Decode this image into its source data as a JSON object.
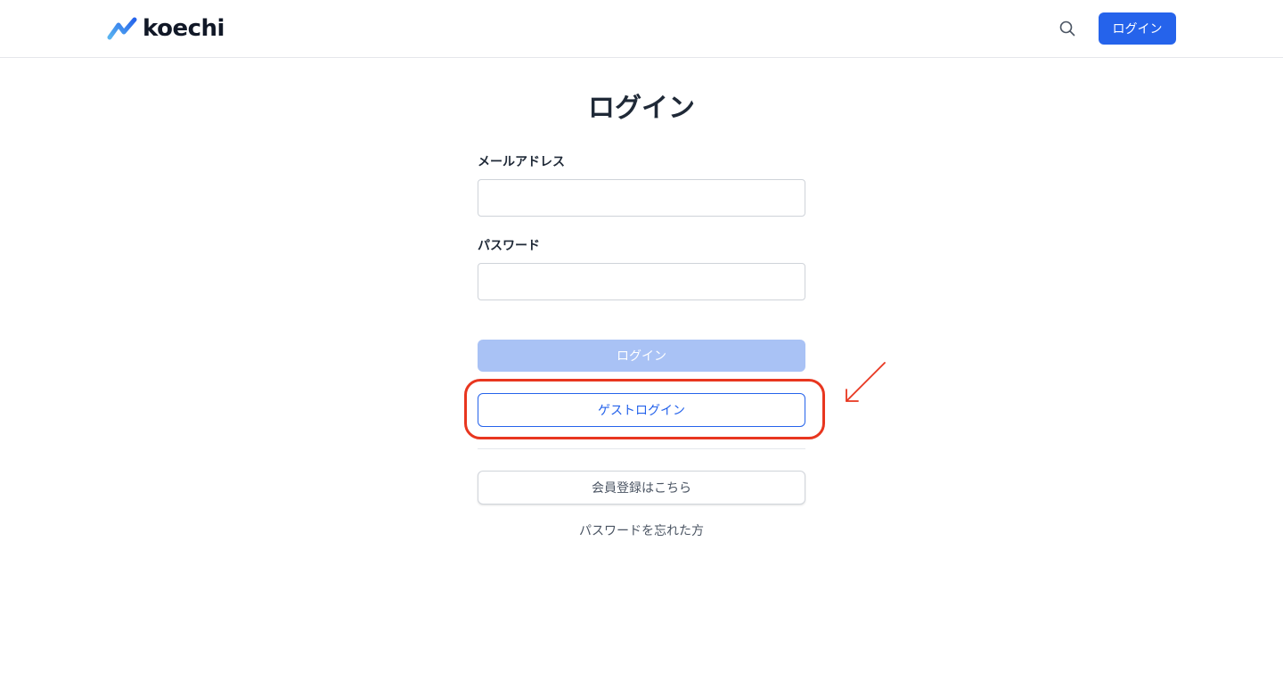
{
  "header": {
    "logo_text": "koechi",
    "search_icon": "search-icon",
    "login_label": "ログイン",
    "accent_color": "#2563eb"
  },
  "main": {
    "title": "ログイン",
    "email_label": "メールアドレス",
    "email_value": "",
    "password_label": "パスワード",
    "password_value": "",
    "submit_label": "ログイン",
    "guest_login_label": "ゲストログイン",
    "register_label": "会員登録はこちら",
    "forgot_password_label": "パスワードを忘れた方"
  },
  "annotation": {
    "highlight_color": "#e8361f",
    "arrow_icon": "arrow-icon"
  }
}
